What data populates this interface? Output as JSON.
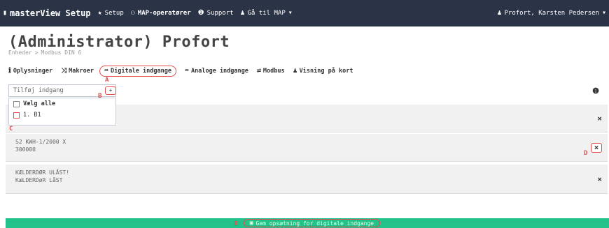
{
  "navbar": {
    "brand": "masterView Setup",
    "items": [
      {
        "label": "Setup",
        "icon": "star-icon"
      },
      {
        "label": "MAP-operatører",
        "icon": "group-icon"
      },
      {
        "label": "Support",
        "icon": "info-icon"
      },
      {
        "label": "Gå til MAP",
        "icon": "people-icon"
      }
    ],
    "user": "Profort, Karsten Pedersen"
  },
  "page": {
    "title": "(Administrator) Profort",
    "breadcrumb": [
      "Enheder",
      ">",
      "Modbus DIN 6"
    ]
  },
  "tabs": [
    {
      "label": "Oplysninger",
      "icon": "info-icon",
      "active": false
    },
    {
      "label": "Makroer",
      "icon": "shuffle-icon",
      "active": false
    },
    {
      "label": "Digitale indgange",
      "icon": "arrow-icon",
      "active": true
    },
    {
      "label": "Analoge indgange",
      "icon": "arrow-icon",
      "active": false
    },
    {
      "label": "Modbus",
      "icon": "exchange-icon",
      "active": false
    },
    {
      "label": "Visning på kort",
      "icon": "people-icon",
      "active": false
    }
  ],
  "add_input": {
    "placeholder": "Tilføj indgang",
    "button": "+"
  },
  "dropdown": {
    "select_all": "Vælg alle",
    "options": [
      "1. B1"
    ]
  },
  "rows": [
    {
      "lines": [
        "...."
      ]
    },
    {
      "lines": [
        "S2 KWH-1/2000 X",
        "300000"
      ]
    },
    {
      "lines": [
        "KÆLDERDØR ULÅST!",
        "KæLDERDøR LåST"
      ]
    }
  ],
  "markers": {
    "a": "A",
    "b": "B",
    "c": "C",
    "d": "D",
    "e": "E"
  },
  "save": {
    "label": "Gem opsætning for digitale indgange"
  },
  "colors": {
    "navbar": "#2b3346",
    "save_bar": "#23c28b",
    "highlight": "#e34a4a"
  }
}
